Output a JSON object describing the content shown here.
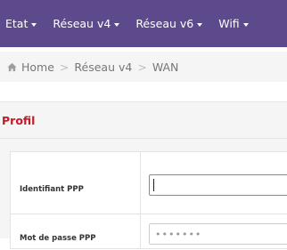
{
  "nav": {
    "items": [
      {
        "label": "Etat"
      },
      {
        "label": "Réseau v4"
      },
      {
        "label": "Réseau v6"
      },
      {
        "label": "Wifi"
      }
    ]
  },
  "breadcrumb": {
    "home": "Home",
    "section": "Réseau v4",
    "current": "WAN",
    "separator": ">"
  },
  "panel": {
    "title": "Profil"
  },
  "form": {
    "ppp_id_label": "Identifiant PPP",
    "ppp_id_value": "",
    "ppp_pass_label": "Mot de passe PPP",
    "ppp_pass_mask": "•••••••"
  },
  "colors": {
    "navbar": "#5c4a8c",
    "panel_title": "#c3192a"
  },
  "icons": {
    "home": "home-icon",
    "caret": "caret-down-icon"
  }
}
